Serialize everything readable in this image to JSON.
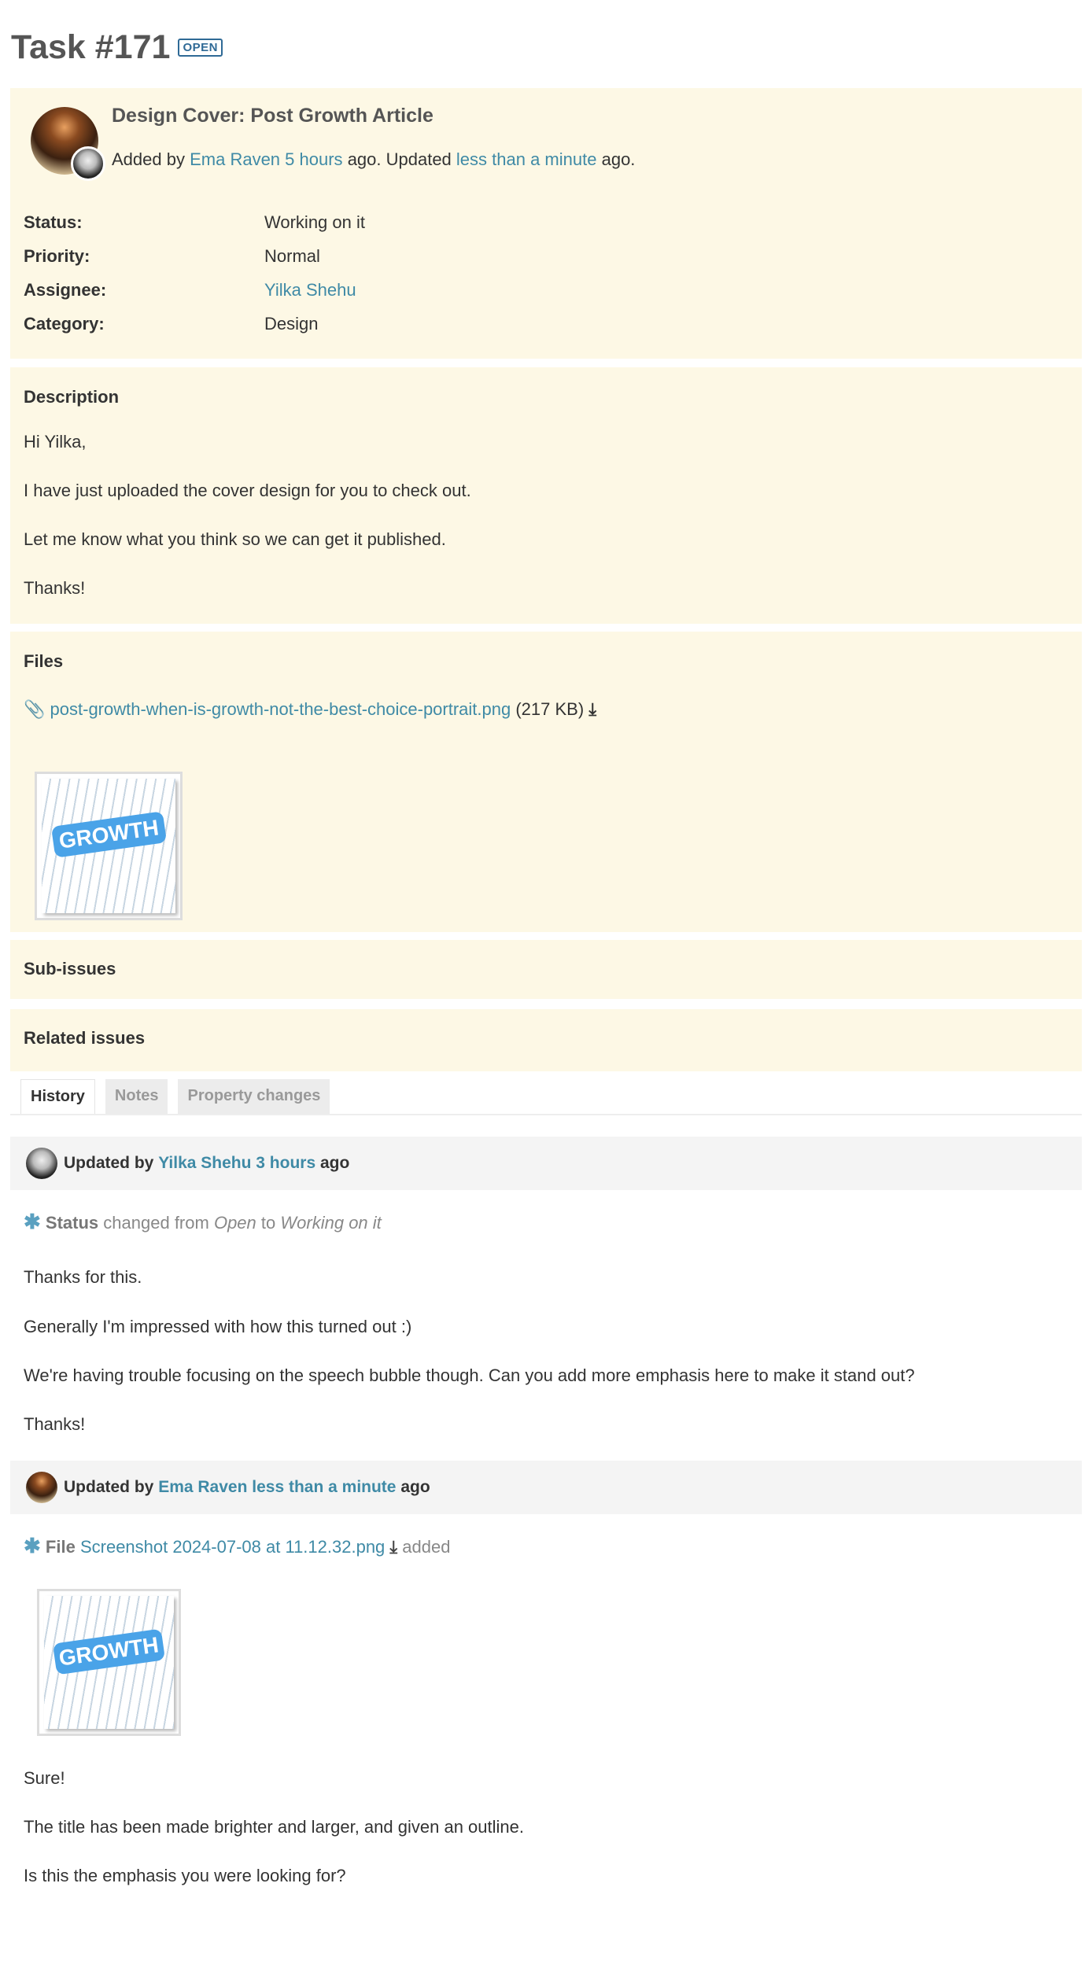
{
  "task": {
    "title": "Task #171",
    "badge": "OPEN"
  },
  "summary": {
    "subject": "Design Cover: Post Growth Article",
    "added_prefix": "Added by",
    "author": "Ema Raven",
    "added_time": "5 hours",
    "added_suffix": "ago. Updated",
    "updated_time": "less than a minute",
    "updated_suffix": "ago.",
    "fields": [
      {
        "label": "Status:",
        "value": "Working on it"
      },
      {
        "label": "Priority:",
        "value": "Normal"
      },
      {
        "label": "Assignee:",
        "value": "Yilka Shehu"
      },
      {
        "label": "Category:",
        "value": "Design"
      }
    ]
  },
  "description": {
    "heading": "Description",
    "paragraphs": [
      "Hi Yilka,",
      "I have just uploaded the cover design for you to check out.",
      "Let me know what you think so we can get it published.",
      "Thanks!"
    ]
  },
  "files": {
    "heading": "Files",
    "filename": "post-growth-when-is-growth-not-the-best-choice-portrait.png",
    "size": "(217 KB)",
    "thumb_text": "GROWTH"
  },
  "subissues": {
    "heading": "Sub-issues"
  },
  "related": {
    "heading": "Related issues"
  },
  "tabs": [
    {
      "label": "History",
      "active": true
    },
    {
      "label": "Notes"
    },
    {
      "label": "Property changes"
    }
  ],
  "history": [
    {
      "prefix": "Updated by",
      "user": "Yilka Shehu",
      "time": "3 hours",
      "suffix": "ago",
      "change": {
        "field": "Status",
        "text1": "changed from",
        "from": "Open",
        "text2": "to",
        "to": "Working on it"
      },
      "paragraphs": [
        "Thanks for this.",
        "Generally I'm impressed with how this turned out :)",
        "We're having trouble focusing on the speech bubble though. Can you add more emphasis here to make it stand out?",
        "Thanks!"
      ]
    },
    {
      "prefix": "Updated by",
      "user": "Ema Raven",
      "time": "less than a minute",
      "suffix": "ago",
      "change": {
        "field": "File",
        "file": "Screenshot 2024-07-08 at 11.12.32.png",
        "text": "added"
      },
      "paragraphs": [
        "Sure!",
        "The title has been made brighter and larger, and given an outline.",
        "Is this the emphasis you were looking for?"
      ]
    }
  ],
  "colors": {
    "panel": "#fdf8e5",
    "link": "#3f8aa6",
    "badge": "#2f6a96"
  }
}
